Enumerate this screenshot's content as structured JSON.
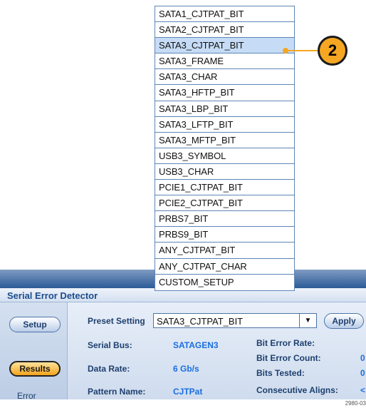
{
  "dropdown": {
    "items": [
      "SATA1_CJTPAT_BIT",
      "SATA2_CJTPAT_BIT",
      "SATA3_CJTPAT_BIT",
      "SATA3_FRAME",
      "SATA3_CHAR",
      "SATA3_HFTP_BIT",
      "SATA3_LBP_BIT",
      "SATA3_LFTP_BIT",
      "SATA3_MFTP_BIT",
      "USB3_SYMBOL",
      "USB3_CHAR",
      "PCIE1_CJTPAT_BIT",
      "PCIE2_CJTPAT_BIT",
      "PRBS7_BIT",
      "PRBS9_BIT",
      "ANY_CJTPAT_BIT",
      "ANY_CJTPAT_CHAR",
      "CUSTOM_SETUP"
    ],
    "selected": "SATA3_CJTPAT_BIT"
  },
  "callout": {
    "number": "2",
    "color": "#f5a623"
  },
  "panel": {
    "title": "Serial Error Detector",
    "nav": {
      "setup": "Setup",
      "results": "Results",
      "error": "Error"
    },
    "preset_label": "Preset Setting",
    "preset_value": "SATA3_CJTPAT_BIT",
    "apply_label": "Apply",
    "serial_bus_label": "Serial Bus:",
    "serial_bus_value": "SATAGEN3",
    "data_rate_label": "Data Rate:",
    "data_rate_value": "6 Gb/s",
    "pattern_name_label": "Pattern Name:",
    "pattern_name_value": "CJTPat",
    "bit_error_rate_label": "Bit Error Rate:",
    "bit_error_count_label": "Bit Error Count:",
    "bit_error_count_value": "0",
    "bits_tested_label": "Bits Tested:",
    "bits_tested_value": "0",
    "consecutive_aligns_label": "Consecutive Aligns:",
    "consecutive_aligns_value": "<"
  },
  "footer_id": "2980-03"
}
